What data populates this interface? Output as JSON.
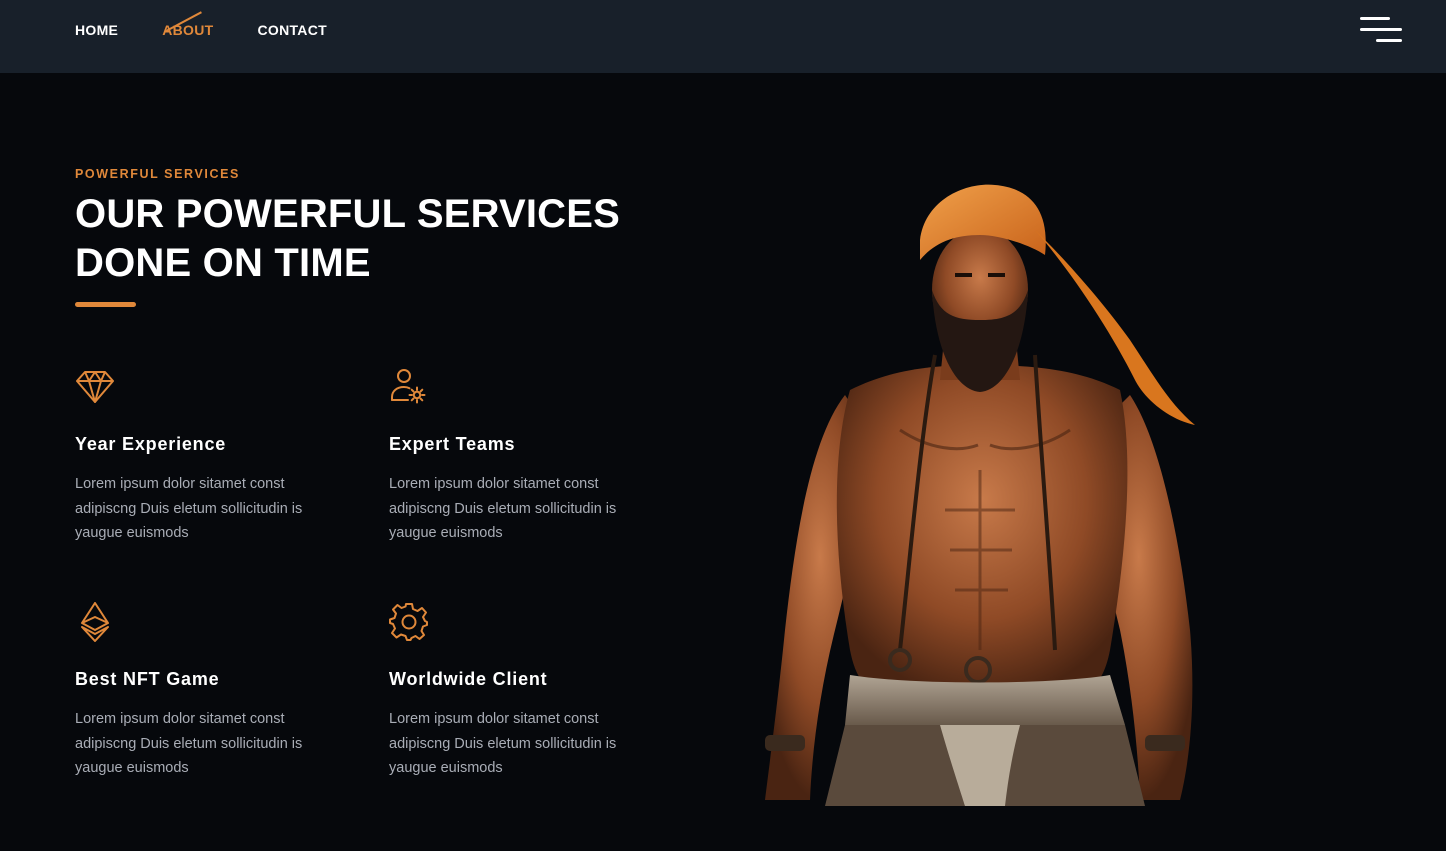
{
  "nav": {
    "items": [
      {
        "label": "HOME"
      },
      {
        "label": "ABOUT"
      },
      {
        "label": "CONTACT"
      }
    ]
  },
  "section": {
    "eyebrow": "POWERFUL SERVICES",
    "headline_line1": "OUR POWERFUL SERVICES",
    "headline_line2": "DONE ON TIME"
  },
  "features": [
    {
      "icon": "diamond-icon",
      "title": "Year Experience",
      "desc": "Lorem ipsum dolor sitamet const adipiscng Duis eletum sollicitudin is yaugue euismods"
    },
    {
      "icon": "user-gear-icon",
      "title": "Expert Teams",
      "desc": "Lorem ipsum dolor sitamet const adipiscng Duis eletum sollicitudin is yaugue euismods"
    },
    {
      "icon": "ethereum-icon",
      "title": "Best NFT Game",
      "desc": "Lorem ipsum dolor sitamet const adipiscng Duis eletum sollicitudin is yaugue euismods"
    },
    {
      "icon": "gear-icon",
      "title": "Worldwide Client",
      "desc": "Lorem ipsum dolor sitamet const adipiscng Duis eletum sollicitudin is yaugue euismods"
    }
  ],
  "colors": {
    "accent": "#e0883a",
    "topbar": "#18202a",
    "background": "#06080c",
    "body_text": "#a9adb6"
  },
  "hero_image": "turbaned-warrior-illustration"
}
